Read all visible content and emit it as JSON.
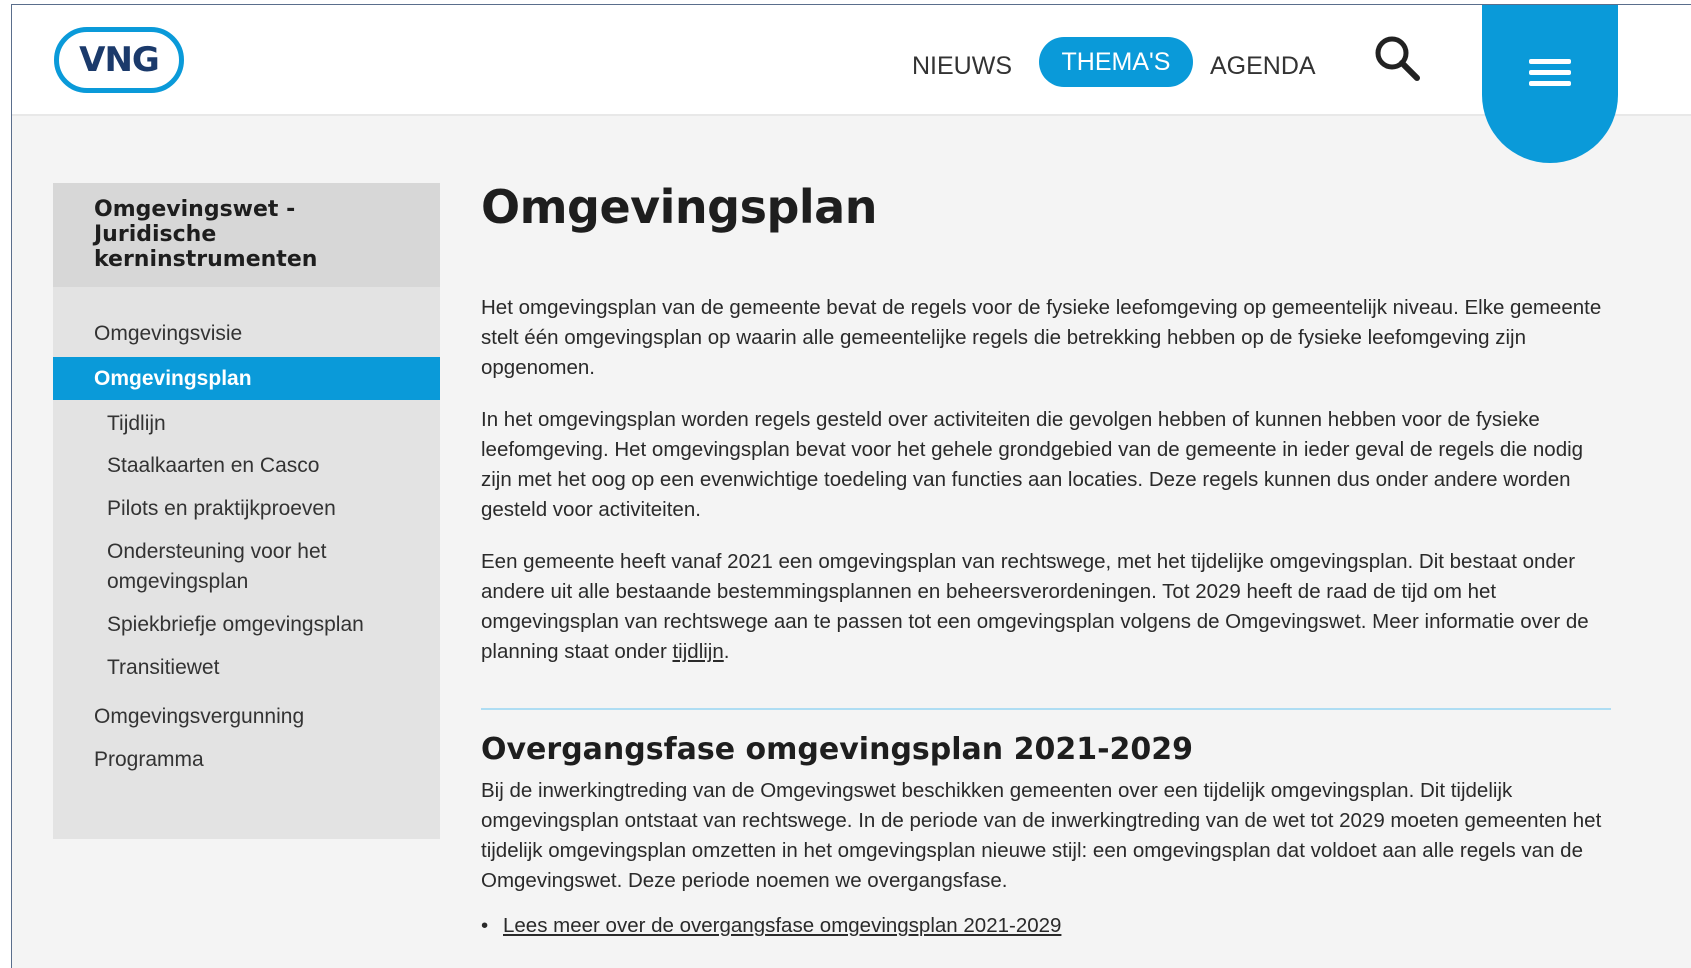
{
  "header": {
    "logo_text": "VNG",
    "nav": [
      {
        "label": "NIEUWS"
      },
      {
        "label": "THEMA'S",
        "active": true
      },
      {
        "label": "AGENDA"
      }
    ],
    "search_icon": "search-icon",
    "menu_icon": "hamburger-menu-icon",
    "accent_color": "#0a9ad9"
  },
  "sidebar": {
    "title": "Omgevingswet -\nJuridische\nkerninstrumenten",
    "items": [
      {
        "label": "Omgevingsvisie",
        "level": 1
      },
      {
        "label": "Omgevingsplan",
        "level": 1,
        "active": true
      },
      {
        "label": "Tijdlijn",
        "level": 2
      },
      {
        "label": "Staalkaarten en Casco",
        "level": 2
      },
      {
        "label": "Pilots en praktijkproeven",
        "level": 2
      },
      {
        "label": "Ondersteuning voor het omgevingsplan",
        "level": 2
      },
      {
        "label": "Spiekbriefje omgevingsplan",
        "level": 2
      },
      {
        "label": "Transitiewet",
        "level": 2
      },
      {
        "label": "Omgevingsvergunning",
        "level": 1
      },
      {
        "label": "Programma",
        "level": 1
      }
    ]
  },
  "main": {
    "title": "Omgevingsplan",
    "paragraphs": [
      "Het omgevingsplan van de gemeente bevat de regels voor de fysieke leefomgeving op gemeentelijk niveau. Elke gemeente stelt één omgevingsplan op waarin alle gemeentelijke regels die betrekking hebben op de fysieke leefomgeving zijn opgenomen.",
      "In het omgevingsplan worden regels gesteld over activiteiten die gevolgen hebben of kunnen hebben voor de fysieke leefomgeving.  Het omgevingsplan bevat voor het gehele grondgebied van de gemeente in ieder geval de regels die nodig zijn met het oog op een evenwichtige toedeling van functies aan locaties. Deze regels kunnen dus onder andere worden gesteld voor  activiteiten.",
      "Een gemeente heeft vanaf 2021 een omgevingsplan van rechtswege, met het tijdelijke omgevingsplan. Dit bestaat onder andere uit alle bestaande bestemmingsplannen en beheersverordeningen. Tot 2029 heeft de raad de tijd om het omgevingsplan van rechtswege aan te passen tot een omgevingsplan volgens de Omgevingswet. Meer informatie over de planning staat onder "
    ],
    "paragraph3_link": "tijdlijn",
    "paragraph3_end": ".",
    "subheading": "Overgangsfase omgevingsplan 2021-2029",
    "sub_paragraph": "Bij de inwerkingtreding van de Omgevingswet beschikken gemeenten over een tijdelijk omgevingsplan. Dit tijdelijk omgevingsplan ontstaat van rechtswege. In de periode van de inwerkingtreding van de wet tot 2029 moeten gemeenten het tijdelijk omgevingsplan omzetten in het omgevingsplan nieuwe stijl: een omgevingsplan dat voldoet aan alle regels van de Omgevingswet. Deze periode noemen we overgangsfase.",
    "bullet_dot": "•",
    "bullet_link": "Lees meer over de overgangsfase omgevingsplan 2021-2029"
  }
}
